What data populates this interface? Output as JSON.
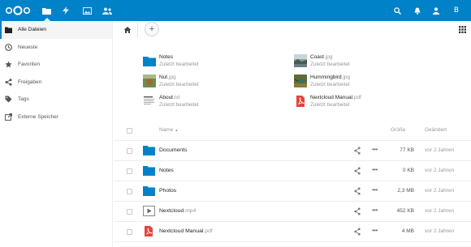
{
  "colors": {
    "brand": "#0082c9",
    "pdf_red": "#e7423b"
  },
  "header": {
    "apps": [
      {
        "name": "files",
        "icon": "folder-icon",
        "active": true
      },
      {
        "name": "activity",
        "icon": "lightning-icon",
        "active": false
      },
      {
        "name": "gallery",
        "icon": "image-icon",
        "active": false
      },
      {
        "name": "contacts",
        "icon": "contacts-icon",
        "active": false
      }
    ],
    "avatar_letter": "B"
  },
  "sidebar": {
    "items": [
      {
        "label": "Alle Dateien",
        "icon": "folder-icon",
        "active": true
      },
      {
        "label": "Neueste",
        "icon": "clock-icon"
      },
      {
        "label": "Favoriten",
        "icon": "star-icon"
      },
      {
        "label": "Freigaben",
        "icon": "share-icon"
      },
      {
        "label": "Tags",
        "icon": "tag-icon"
      },
      {
        "label": "Externe Speicher",
        "icon": "external-icon"
      }
    ]
  },
  "toolbar": {
    "add_label": "+"
  },
  "recent": [
    {
      "name": "Notes",
      "ext": "",
      "meta": "Zuletzt bearbeitet",
      "thumb": "folder"
    },
    {
      "name": "Coast",
      "ext": ".jpg",
      "meta": "Zuletzt bearbeitet",
      "thumb": "photo-coast"
    },
    {
      "name": "Nut",
      "ext": ".jpg",
      "meta": "Zuletzt bearbeitet",
      "thumb": "photo-nut"
    },
    {
      "name": "Hummingbird",
      "ext": ".jpg",
      "meta": "Zuletzt bearbeitet",
      "thumb": "photo-bird"
    },
    {
      "name": "About",
      "ext": ".txt",
      "meta": "Zuletzt bearbeitet",
      "thumb": "text"
    },
    {
      "name": "Nextcloud Manual",
      "ext": ".pdf",
      "meta": "Zuletzt bearbeitet",
      "thumb": "pdf"
    }
  ],
  "table": {
    "headers": {
      "name": "Name",
      "sort_indicator": "▲",
      "size": "Größe",
      "modified": "Geändert"
    },
    "rows": [
      {
        "name": "Documents",
        "ext": "",
        "size": "77 KB",
        "modified": "vor 2 Jahren",
        "type": "folder"
      },
      {
        "name": "Notes",
        "ext": "",
        "size": "0 KB",
        "modified": "vor 2 Jahren",
        "type": "folder"
      },
      {
        "name": "Photos",
        "ext": "",
        "size": "2,3 MB",
        "modified": "vor 2 Jahren",
        "type": "folder"
      },
      {
        "name": "Nextcloud",
        "ext": ".mp4",
        "size": "452 KB",
        "modified": "vor 2 Jahren",
        "type": "video"
      },
      {
        "name": "Nextcloud Manual",
        "ext": ".pdf",
        "size": "4 MB",
        "modified": "vor 2 Jahren",
        "type": "pdf"
      }
    ],
    "more_label": "•••"
  }
}
